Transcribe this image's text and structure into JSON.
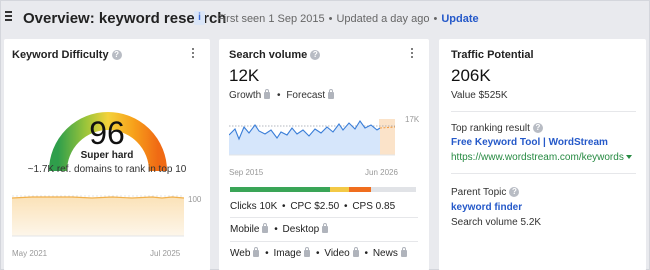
{
  "header": {
    "title": "Overview: keyword research",
    "info_badge": "i",
    "first_seen": "First seen 1 Sep 2015",
    "updated": "Updated a day ago",
    "update_link": "Update",
    "separator": "•"
  },
  "keyword_difficulty": {
    "title": "Keyword Difficulty",
    "help": "?",
    "value": "96",
    "label": "Super hard",
    "subtext": "~1.7K ref. domains to rank in top 10",
    "chart": {
      "y_max_label": "100",
      "x_start": "May 2021",
      "x_end": "Jul 2025"
    }
  },
  "search_volume": {
    "title": "Search volume",
    "help": "?",
    "value": "12K",
    "growth": "Growth",
    "forecast": "Forecast",
    "chart": {
      "y_label": "17K",
      "x_start": "Sep 2015",
      "x_end": "Jun 2026"
    },
    "intent_bar": [
      {
        "color": "#3aa557",
        "share": 0.54
      },
      {
        "color": "#f3c946",
        "share": 0.1
      },
      {
        "color": "#f06e1e",
        "share": 0.12
      },
      {
        "color": "#e1e3e7",
        "share": 0.24
      }
    ],
    "metrics": {
      "clicks": "Clicks 10K",
      "cpc": "CPC $2.50",
      "cps": "CPS 0.85",
      "dot": "•"
    },
    "devices": {
      "mobile": "Mobile",
      "desktop": "Desktop",
      "dot": "•"
    },
    "serp": {
      "web": "Web",
      "image": "Image",
      "video": "Video",
      "news": "News",
      "dot": "•"
    }
  },
  "traffic_potential": {
    "title": "Traffic Potential",
    "value": "206K",
    "value_label": "Value $525K",
    "top_ranking_label": "Top ranking result",
    "help": "?",
    "top_result_title": "Free Keyword Tool | WordStream",
    "top_result_url": "https://www.wordstream.com/keywords",
    "parent_topic_label": "Parent Topic",
    "parent_topic": "keyword finder",
    "parent_volume": "Search volume 5.2K"
  }
}
